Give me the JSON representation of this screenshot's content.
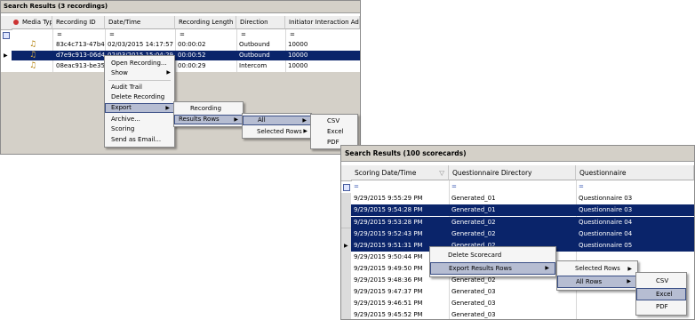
{
  "panel1": {
    "title": "Search Results (3 recordings)",
    "columns": [
      "Media Typ",
      "Recording ID",
      "Date/Time",
      "Recording Length",
      "Direction",
      "Initiator Interaction Address"
    ],
    "filter_eq": "=",
    "rows": [
      {
        "id": "83c4c713-47b4-...",
        "datetime": "02/03/2015 14:17:57",
        "length": "00:00:02",
        "direction": "Outbound",
        "address": "10000"
      },
      {
        "id": "d7e9c913-06d4...",
        "datetime": "02/03/2015 15:04:29",
        "length": "00:00:52",
        "direction": "Outbound",
        "address": "10000"
      },
      {
        "id": "08eac913-be35...",
        "datetime": "",
        "length": "00:00:29",
        "direction": "Intercom",
        "address": "10000"
      }
    ]
  },
  "context_menu_1": {
    "items": [
      "Open Recording...",
      "Show",
      "Audit Trail",
      "Delete Recording",
      "Export",
      "Archive...",
      "Scoring",
      "Send as Email..."
    ]
  },
  "export_submenu": {
    "items": [
      "Recording",
      "Results Rows"
    ]
  },
  "results_rows_submenu": {
    "items": [
      "All",
      "Selected Rows"
    ]
  },
  "all_submenu": {
    "items": [
      "CSV",
      "Excel",
      "PDF"
    ]
  },
  "panel2": {
    "title": "Search Results (100 scorecards)",
    "columns": [
      "Scoring Date/Time",
      "Questionnaire Directory",
      "Questionnaire"
    ],
    "filter_eq": "=",
    "rows": [
      {
        "datetime": "9/29/2015 9:55:29 PM",
        "directory": "Generated_01",
        "questionnaire": "Questionnaire 03",
        "selected": false
      },
      {
        "datetime": "9/29/2015 9:54:28 PM",
        "directory": "Generated_01",
        "questionnaire": "Questionnaire 03",
        "selected": true
      },
      {
        "datetime": "9/29/2015 9:53:28 PM",
        "directory": "Generated_02",
        "questionnaire": "Questionnaire 04",
        "selected": true
      },
      {
        "datetime": "9/29/2015 9:52:43 PM",
        "directory": "Generated_02",
        "questionnaire": "Questionnaire 04",
        "selected": true
      },
      {
        "datetime": "9/29/2015 9:51:31 PM",
        "directory": "Generated_02",
        "questionnaire": "Questionnaire 05",
        "selected": true
      },
      {
        "datetime": "9/29/2015 9:50:44 PM",
        "directory": "",
        "questionnaire": "",
        "selected": false
      },
      {
        "datetime": "9/29/2015 9:49:50 PM",
        "directory": "",
        "questionnaire": "",
        "selected": false
      },
      {
        "datetime": "9/29/2015 9:48:36 PM",
        "directory": "Generated_02",
        "questionnaire": "",
        "selected": false
      },
      {
        "datetime": "9/29/2015 9:47:37 PM",
        "directory": "Generated_03",
        "questionnaire": "",
        "selected": false
      },
      {
        "datetime": "9/29/2015 9:46:51 PM",
        "directory": "Generated_03",
        "questionnaire": "",
        "selected": false
      },
      {
        "datetime": "9/29/2015 9:45:52 PM",
        "directory": "Generated_03",
        "questionnaire": "",
        "selected": false
      }
    ]
  },
  "context_menu_2": {
    "items": [
      "Delete Scorecard",
      "Export Results Rows"
    ]
  },
  "export_rows_submenu": {
    "items": [
      "Selected Rows",
      "All Rows"
    ]
  },
  "all_rows_submenu": {
    "items": [
      "CSV",
      "Excel",
      "PDF"
    ]
  },
  "colors": {
    "selection": "#0a246a",
    "menu_highlight": "#b6bdd2",
    "header_bg": "#eeeeee"
  }
}
